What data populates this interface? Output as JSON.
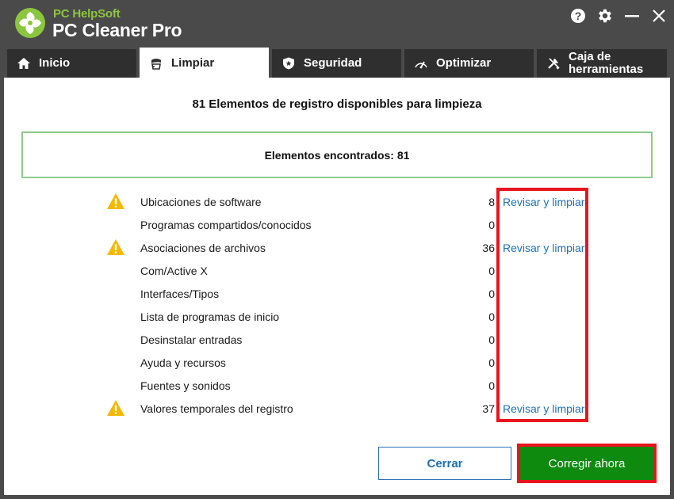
{
  "app": {
    "brand_small": "PC HelpSoft",
    "brand_big": "PC Cleaner Pro"
  },
  "window_controls": [
    {
      "icon": "help-icon"
    },
    {
      "icon": "gear-icon"
    },
    {
      "icon": "minimize-icon"
    },
    {
      "icon": "close-icon"
    }
  ],
  "tabs": [
    {
      "label": "Inicio",
      "icon": "home-icon",
      "active": false
    },
    {
      "label": "Limpiar",
      "icon": "broom-icon",
      "active": true
    },
    {
      "label": "Seguridad",
      "icon": "shield-icon",
      "active": false
    },
    {
      "label": "Optimizar",
      "icon": "speedometer-icon",
      "active": false
    },
    {
      "label": "Caja de herramientas",
      "icon": "tools-icon",
      "active": false
    }
  ],
  "main": {
    "headline": "81 Elementos de registro disponibles para limpieza",
    "found_text": "Elementos encontrados: 81"
  },
  "items": [
    {
      "label": "Ubicaciones de software",
      "count": "8",
      "warning": true,
      "action": "Revisar y limpiar"
    },
    {
      "label": "Programas compartidos/conocidos",
      "count": "0",
      "warning": false,
      "action": ""
    },
    {
      "label": "Asociaciones de archivos",
      "count": "36",
      "warning": true,
      "action": "Revisar y limpiar"
    },
    {
      "label": "Com/Active X",
      "count": "0",
      "warning": false,
      "action": ""
    },
    {
      "label": "Interfaces/Tipos",
      "count": "0",
      "warning": false,
      "action": ""
    },
    {
      "label": "Lista de programas de inicio",
      "count": "0",
      "warning": false,
      "action": ""
    },
    {
      "label": "Desinstalar entradas",
      "count": "0",
      "warning": false,
      "action": ""
    },
    {
      "label": "Ayuda y recursos",
      "count": "0",
      "warning": false,
      "action": ""
    },
    {
      "label": "Fuentes y sonidos",
      "count": "0",
      "warning": false,
      "action": ""
    },
    {
      "label": "Valores temporales del registro",
      "count": "37",
      "warning": true,
      "action": "Revisar y limpiar"
    }
  ],
  "buttons": {
    "close_label": "Cerrar",
    "fix_label": "Corregir ahora"
  },
  "colors": {
    "accent_green": "#8cc63f",
    "link_blue": "#1f6fb5",
    "fix_button": "#0e8a0e",
    "highlight_red": "#e8141e",
    "warning_yellow": "#f5b800"
  }
}
